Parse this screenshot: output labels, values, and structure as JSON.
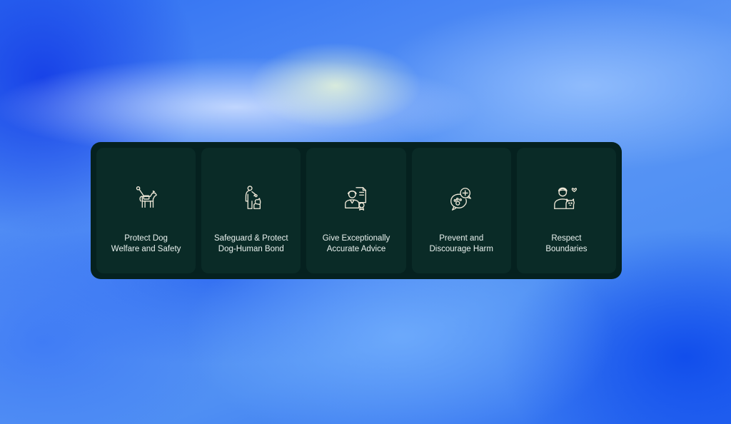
{
  "cards": [
    {
      "icon": "guide-dog-icon",
      "line1": "Protect Dog",
      "line2": "Welfare and Safety"
    },
    {
      "icon": "person-with-dog-icon",
      "line1": "Safeguard & Protect",
      "line2": "Dog-Human Bond"
    },
    {
      "icon": "expert-certificate-icon",
      "line1": "Give Exceptionally",
      "line2": "Accurate Advice"
    },
    {
      "icon": "paw-medical-chat-icon",
      "line1": "Prevent and",
      "line2": "Discourage Harm"
    },
    {
      "icon": "owner-with-dog-heart-icon",
      "line1": "Respect",
      "line2": "Boundaries"
    }
  ],
  "colors": {
    "panel": "#05211f",
    "card": "#0a2b27",
    "text": "#e9f1ee",
    "icon": "#efe8d8"
  }
}
